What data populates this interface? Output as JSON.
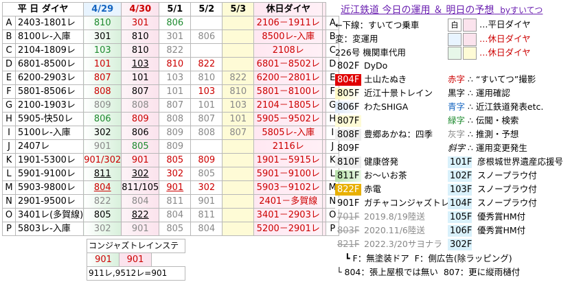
{
  "header": {
    "weekday": "平 日 ダイヤ",
    "d1": "4/29",
    "d2": "4/30",
    "d3": "5/1",
    "d4": "5/2",
    "d5": "5/3",
    "holiday": "休日ダイヤ"
  },
  "title": {
    "main": "近江鉄道 今日の運用 ＆ 明日の予想",
    "by": "byすいてつ"
  },
  "rows": [
    {
      "id": "A",
      "name": "2403-1801レ",
      "v": [
        "810",
        "301",
        "806",
        "",
        ""
      ],
      "hol": "2106－1911レ"
    },
    {
      "id": "B",
      "name": "8100レ-入庫",
      "v": [
        "301",
        "810",
        "301",
        "806",
        ""
      ],
      "hol": "8500レ-入庫"
    },
    {
      "id": "C",
      "name": "2104-1809レ",
      "v": [
        "103",
        "810",
        "822",
        "",
        ""
      ],
      "hol": "2108レ"
    },
    {
      "id": "D",
      "name": "6801-8500レ",
      "v": [
        "101",
        "103",
        "810",
        "822",
        ""
      ],
      "hol": "6801－8502レ"
    },
    {
      "id": "E",
      "name": "6200-2903レ",
      "v": [
        "807",
        "101",
        "103",
        "810",
        "822"
      ],
      "hol": "6200－2801レ"
    },
    {
      "id": "F",
      "name": "5801-8506レ",
      "v": [
        "808",
        "807",
        "101",
        "103",
        "810"
      ],
      "hol": "5801－8100レ"
    },
    {
      "id": "G",
      "name": "2100-1903レ",
      "v": [
        "809",
        "808",
        "807",
        "101",
        "103"
      ],
      "hol": "2104－1805レ"
    },
    {
      "id": "H",
      "name": "5905-快50レ",
      "v": [
        "806",
        "809",
        "808",
        "807",
        "101"
      ],
      "hol": "5905－9502レ"
    },
    {
      "id": "I",
      "name": "5100レ-入庫",
      "v": [
        "302",
        "806",
        "809",
        "808",
        "807"
      ],
      "hol": "5805レ-入庫"
    },
    {
      "id": "J",
      "name": "2407レ",
      "v": [
        "901",
        "805",
        "809",
        "",
        ""
      ],
      "hol": "2116レ"
    },
    {
      "id": "K",
      "name": "1901-5300レ",
      "v": [
        "901/302",
        "901",
        "805",
        "809",
        ""
      ],
      "hol": "1901－5915レ"
    },
    {
      "id": "L",
      "name": "5901-9100レ",
      "v": [
        "811",
        "302",
        "302",
        "805",
        ""
      ],
      "hol": "5901－9100レ"
    },
    {
      "id": "M",
      "name": "5903-9800レ",
      "v": [
        "804",
        "811/105",
        "901",
        "302",
        ""
      ],
      "hol": "5903－9102レ"
    },
    {
      "id": "N",
      "name": "2901-9500レ",
      "v": [
        "822",
        "804",
        "811",
        "901",
        ""
      ],
      "hol": "2401－多賀線"
    },
    {
      "id": "O",
      "name": "3401レ(多賀線)",
      "v": [
        "805",
        "822",
        "804",
        "811",
        ""
      ],
      "hol": "3401－2903レ"
    },
    {
      "id": "P",
      "name": "5803レ-入庫",
      "v": [
        "302",
        "901",
        "805",
        "804",
        ""
      ],
      "hol": "5200－2901レ"
    }
  ],
  "bottom": {
    "stage": "コンジャズトレインステージ",
    "v1": "901",
    "v2": "901",
    "note": "911レ,9512レ=901"
  },
  "legend": {
    "l1": "←下線：すいてつ乗車",
    "l2": "変：変運用",
    "l3": "226号 機関車代用",
    "w1": "白",
    "w1t": "…平日ダイヤ",
    "w2t": "…休日ダイヤ",
    "w3t": "…休日ダイヤ",
    "trains": [
      {
        "code": "802F",
        "name": "DyDo"
      },
      {
        "code": "804F",
        "name": "土山たぬき"
      },
      {
        "code": "805F",
        "name": "近江十景トレイン"
      },
      {
        "code": "806F",
        "name": "わたSHIGA"
      },
      {
        "code": "807F",
        "name": ""
      },
      {
        "code": "808F",
        "name": "豊郷あかね：四季"
      },
      {
        "code": "809F",
        "name": ""
      },
      {
        "code": "810F",
        "name": "健康啓発"
      },
      {
        "code": "811F",
        "name": "お～いお茶"
      },
      {
        "code": "822F",
        "name": "赤電"
      },
      {
        "code": "901F",
        "name": "ガチャコンジャズトレイン"
      },
      {
        "code": "701F",
        "name": "2019.8/19陸送"
      },
      {
        "code": "803F",
        "name": "2020.11/6陸送"
      },
      {
        "code": "821F",
        "name": "2022.3/20サヨナラ"
      }
    ],
    "colors": [
      {
        "k": "赤字",
        "t": "“すいてつ”撮影"
      },
      {
        "k": "黒字",
        "t": "運用確認"
      },
      {
        "k": "青字",
        "t": "近江鉄道発表etc."
      },
      {
        "k": "緑字",
        "t": "伝聞・検索"
      },
      {
        "k": "灰字",
        "t": "推測・予想"
      },
      {
        "k": "斜字",
        "t": "運用変更発生"
      }
    ],
    "small": [
      {
        "code": "101F",
        "t": "彦根城世界遺産応援号"
      },
      {
        "code": "102F",
        "t": "スノープラウ付"
      },
      {
        "code": "103F",
        "t": "スノープラウ付"
      },
      {
        "code": "104F",
        "t": "スノープラウ付"
      },
      {
        "code": "105F",
        "t": "優秀賞HM付"
      },
      {
        "code": "106F",
        "t": "優秀賞HM付"
      },
      {
        "code": "302F",
        "t": ""
      }
    ],
    "foot1a": "┗ F：無塗装ドア",
    "foot1b": "F：側広告(除ラッピング)",
    "foot2a": "└ 804：張上屋根では無い",
    "foot2b": "807：更に縦雨樋付"
  },
  "colors": {
    "accent": "#6a1fb0",
    "red": "#cc0000",
    "green": "#1d8a2e",
    "blue": "#1565c0",
    "gray": "#888888"
  }
}
